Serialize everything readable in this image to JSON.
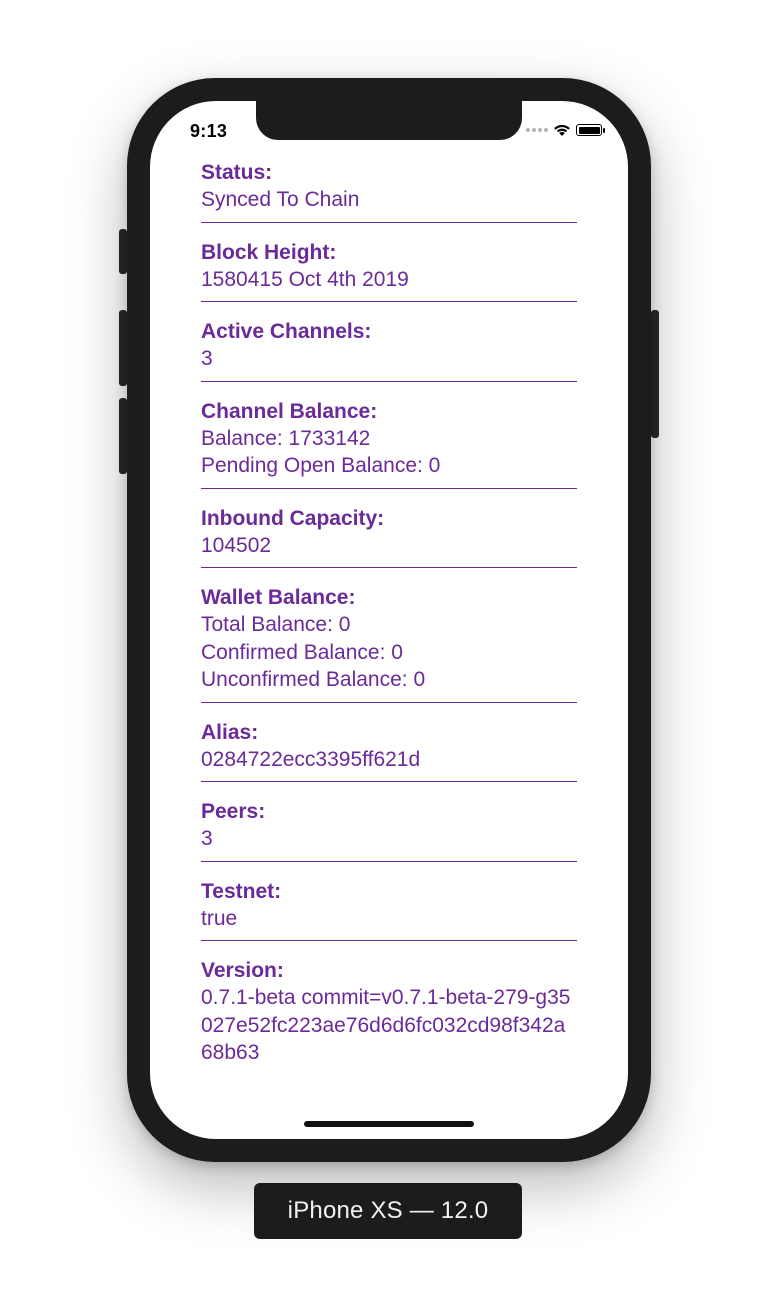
{
  "status_bar": {
    "time": "9:13"
  },
  "sections": [
    {
      "title": "Status:",
      "lines": [
        "Synced To Chain"
      ]
    },
    {
      "title": "Block Height:",
      "lines": [
        "1580415  Oct 4th 2019"
      ]
    },
    {
      "title": "Active Channels:",
      "lines": [
        "3"
      ]
    },
    {
      "title": "Channel Balance:",
      "lines": [
        "Balance: 1733142",
        "Pending Open Balance: 0"
      ]
    },
    {
      "title": "Inbound Capacity:",
      "lines": [
        "104502"
      ]
    },
    {
      "title": "Wallet Balance:",
      "lines": [
        "Total Balance: 0",
        "Confirmed Balance: 0",
        "Unconfirmed Balance: 0"
      ]
    },
    {
      "title": "Alias:",
      "lines": [
        "0284722ecc3395ff621d"
      ]
    },
    {
      "title": "Peers:",
      "lines": [
        "3"
      ]
    },
    {
      "title": "Testnet:",
      "lines": [
        "true"
      ]
    },
    {
      "title": "Version:",
      "lines": [
        "0.7.1-beta commit=v0.7.1-beta-279-g35027e52fc223ae76d6d6fc032cd98f342a68b63"
      ]
    }
  ],
  "device_label": "iPhone XS — 12.0",
  "colors": {
    "accent": "#6b2a98",
    "bezel": "#1c1c1e"
  },
  "icons": {
    "signal": "cellular-signal-icon",
    "wifi": "wifi-icon",
    "battery": "battery-icon"
  }
}
